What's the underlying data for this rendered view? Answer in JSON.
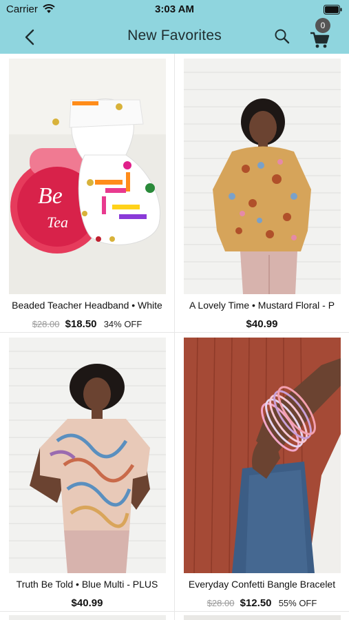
{
  "status_bar": {
    "carrier": "Carrier",
    "time": "3:03 AM"
  },
  "nav": {
    "title": "New Favorites",
    "cart_count": "0"
  },
  "colors": {
    "header_bg": "#8fd5de",
    "badge_bg": "#555555"
  },
  "products": [
    {
      "name": "Beaded Teacher Headband • White",
      "original_price": "$28.00",
      "price": "$18.50",
      "discount": "34% OFF"
    },
    {
      "name": "A Lovely Time • Mustard Floral - P",
      "original_price": "",
      "price": "$40.99",
      "discount": ""
    },
    {
      "name": "Truth Be Told • Blue Multi - PLUS",
      "original_price": "",
      "price": "$40.99",
      "discount": ""
    },
    {
      "name": "Everyday Confetti Bangle Bracelet",
      "original_price": "$28.00",
      "price": "$12.50",
      "discount": "55% OFF"
    }
  ]
}
